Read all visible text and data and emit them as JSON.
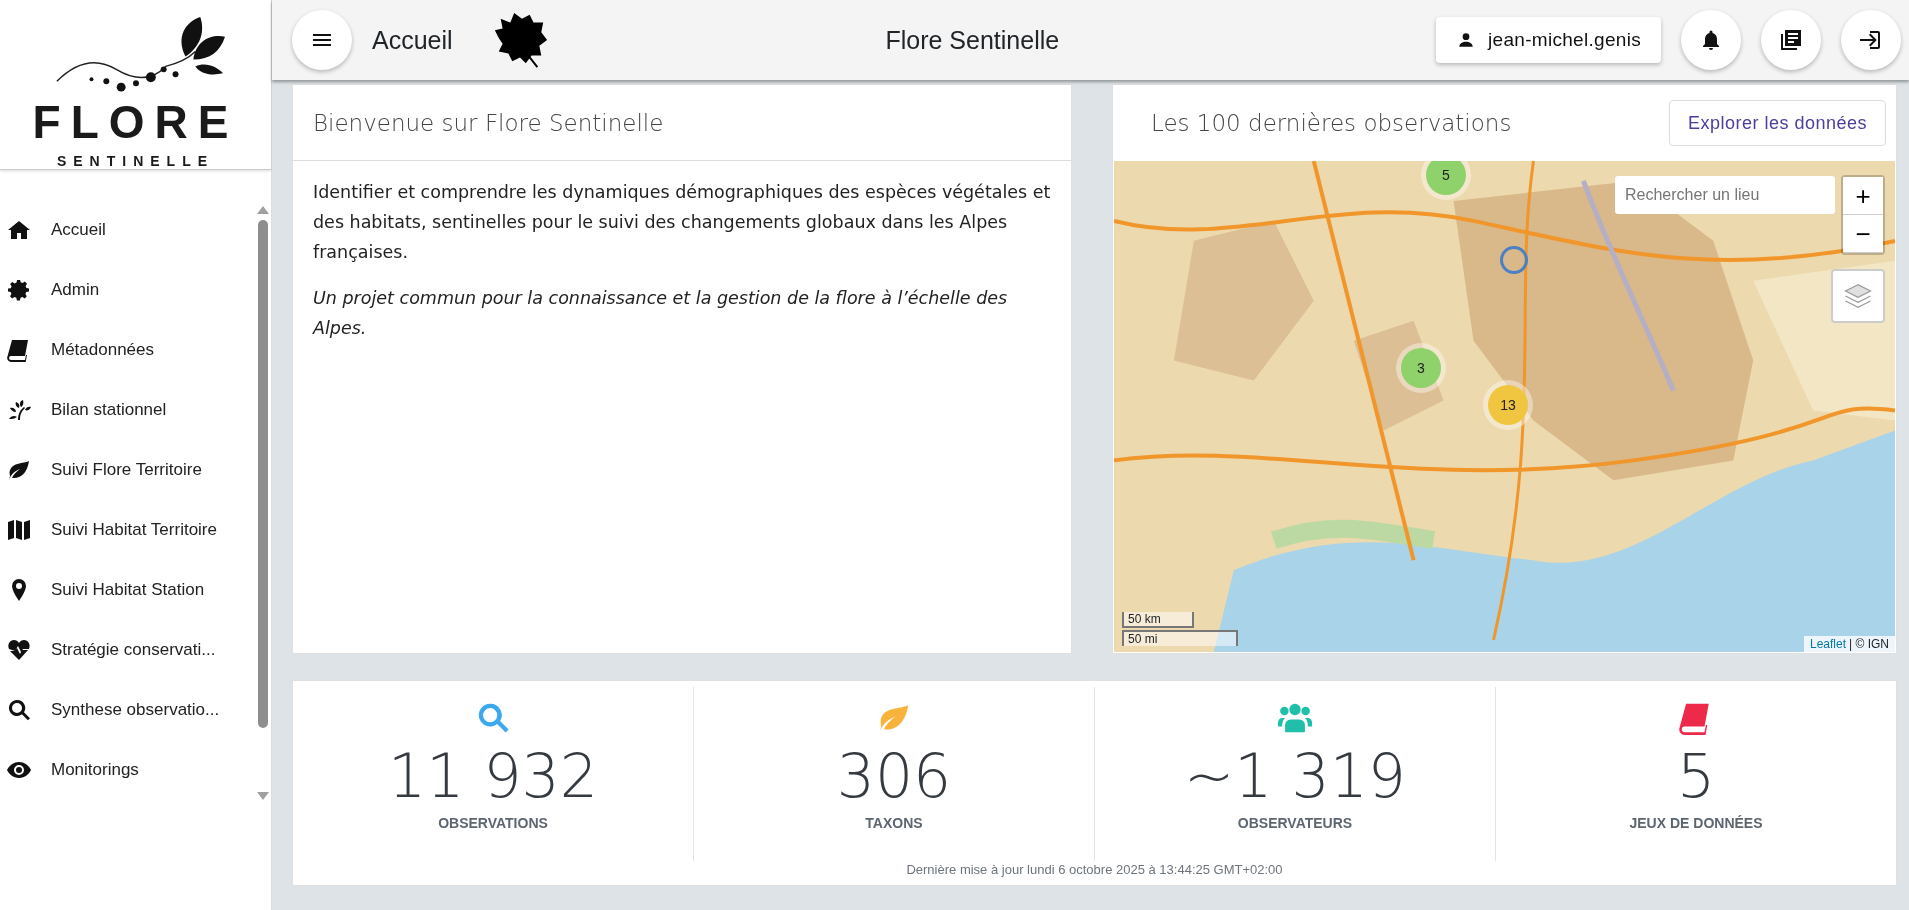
{
  "sidebar": {
    "logo": {
      "title": "FLORE",
      "subtitle": "SENTINELLE"
    },
    "items": [
      {
        "label": "Accueil",
        "kind": "home",
        "selected": false
      },
      {
        "label": "Admin",
        "kind": "gear",
        "selected": false
      },
      {
        "label": "Métadonnées",
        "kind": "book",
        "selected": false
      },
      {
        "label": "Bilan stationnel",
        "kind": "sprout",
        "selected": false
      },
      {
        "label": "Suivi Flore Territoire",
        "kind": "leaf",
        "selected": false
      },
      {
        "label": "Suivi Habitat Territoire",
        "kind": "map",
        "selected": false
      },
      {
        "label": "Suivi Habitat Station",
        "kind": "pin",
        "selected": false
      },
      {
        "label": "Stratégie conservati...",
        "kind": "heartbeat",
        "selected": false
      },
      {
        "label": "Synthese observatio...",
        "kind": "search",
        "selected": false
      },
      {
        "label": "Monitorings",
        "kind": "eye",
        "selected": false
      }
    ]
  },
  "header": {
    "page": "Accueil",
    "title": "Flore Sentinelle",
    "user": "jean-michel.genis"
  },
  "welcome": {
    "title": "Bienvenue sur Flore Sentinelle",
    "paragraphs": [
      {
        "text": "Identifier et comprendre les dynamiques démographiques des espèces végétales et des habitats, sentinelles pour le suivi des changements globaux dans les Alpes françaises.",
        "italic": false
      },
      {
        "text": "Un projet commun pour la connaissance et la gestion de la flore à l’échelle des Alpes.",
        "italic": true
      }
    ]
  },
  "map_card": {
    "title": "Les 100 dernières observations",
    "button": "Explorer les données",
    "map": {
      "search": {
        "placeholder": "Rechercher un lieu"
      },
      "zoom_in": "+",
      "zoom_out": "−",
      "clusters": [
        {
          "count": "5",
          "color": "#8fd16a"
        },
        {
          "count": "3",
          "color": "#8fd16a"
        },
        {
          "count": "13",
          "color": "#f0c640"
        }
      ],
      "scale": [
        "50 km",
        "50 mi"
      ],
      "attribution_link": "Leaflet",
      "attribution": "| © IGN"
    }
  },
  "stats": {
    "items": [
      {
        "value": "11 932",
        "label": "OBSERVATIONS",
        "kind": "search",
        "color": "#3ba8f0"
      },
      {
        "value": "306",
        "label": "TAXONS",
        "kind": "leaf",
        "color": "#f9b33c"
      },
      {
        "value": "~1 319",
        "label": "OBSERVATEURS",
        "kind": "users",
        "color": "#20bfa9"
      },
      {
        "value": "5",
        "label": "JEUX DE DONNÉES",
        "kind": "book",
        "color": "#ee2a4a"
      }
    ],
    "updated": "Dernière mise à jour lundi 6 octobre 2025 à 13:44:25 GMT+02:00"
  }
}
